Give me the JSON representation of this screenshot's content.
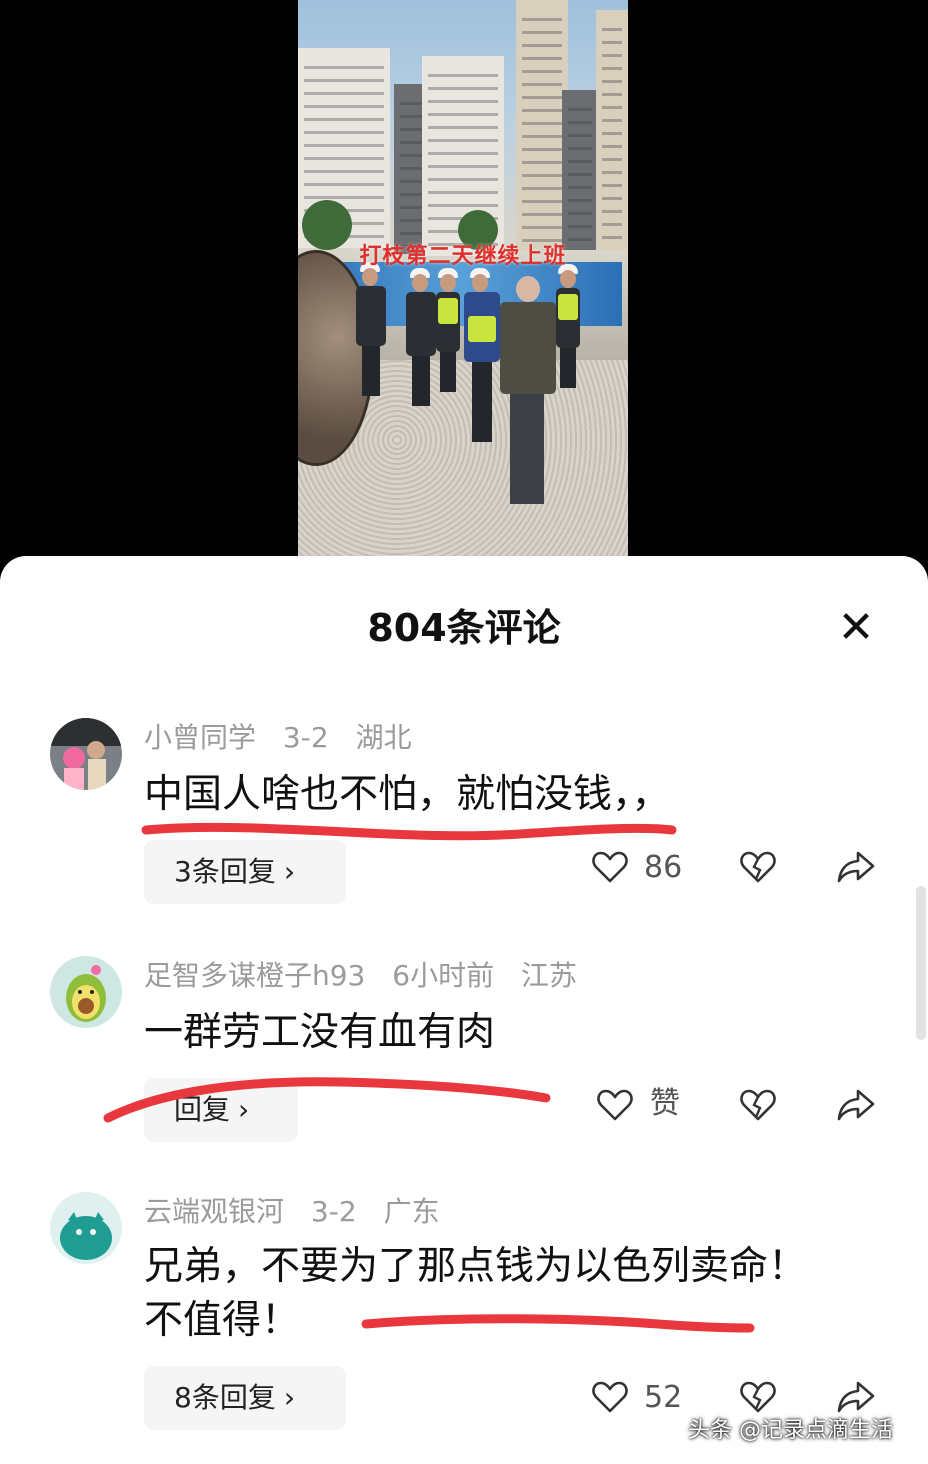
{
  "video": {
    "overlay_caption": "打枝第二天继续上班"
  },
  "sheet": {
    "title": "804条评论",
    "close_icon": "close-icon"
  },
  "comments": [
    {
      "user": "小曾同学",
      "date": "3-2",
      "location": "湖北",
      "text": "中国人啥也不怕，就怕没钱，，",
      "reply_label": "3条回复",
      "like_label": "86",
      "accent": "#e8383d"
    },
    {
      "user": "足智多谋橙子h93",
      "date": "6小时前",
      "location": "江苏",
      "text": "一群劳工没有血有肉",
      "reply_label": "回复",
      "like_label": "赞",
      "accent": "#e8383d"
    },
    {
      "user": "云端观银河",
      "date": "3-2",
      "location": "广东",
      "text": "兄弟，不要为了那点钱为以色列卖命！不值得！",
      "reply_label": "8条回复",
      "like_label": "52",
      "accent": "#e8383d"
    }
  ],
  "watermark": "头条 @记录点滴生活",
  "colors": {
    "meta_gray": "#9b9b9b",
    "scribble_red": "#e8383d",
    "pill_bg": "#f5f5f5"
  }
}
